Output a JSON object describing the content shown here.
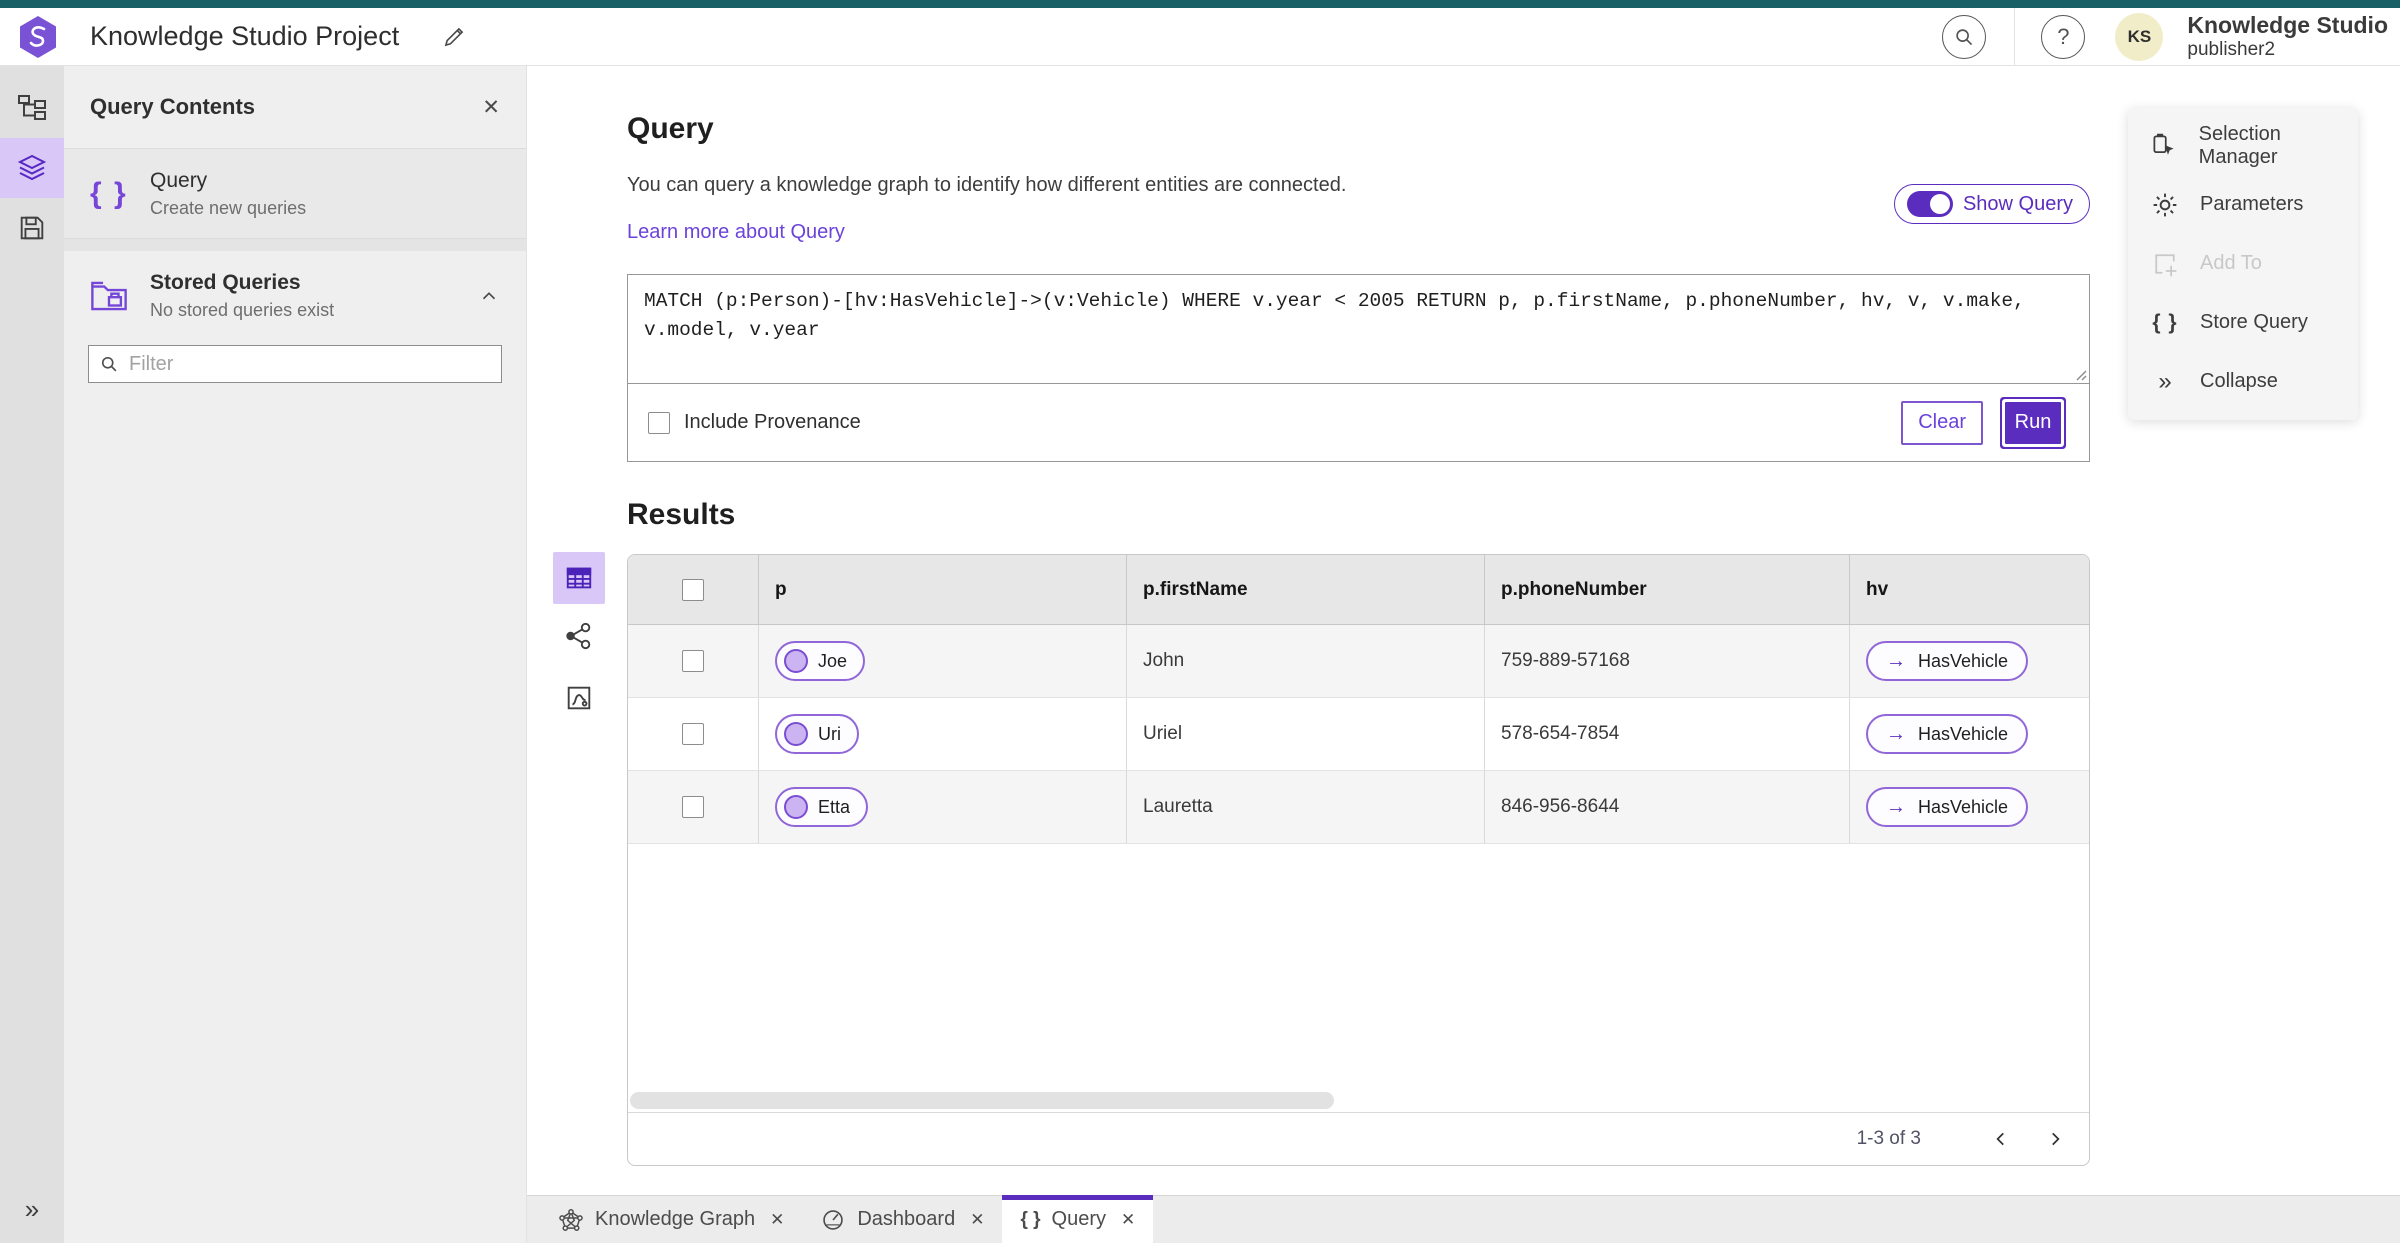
{
  "header": {
    "app_title": "Knowledge Studio Project",
    "user_name": "Knowledge Studio",
    "user_role": "publisher2",
    "avatar_initials": "KS"
  },
  "panel": {
    "title": "Query Contents",
    "query_item": {
      "label": "Query",
      "sublabel": "Create new queries"
    },
    "stored_item": {
      "label": "Stored Queries",
      "sublabel": "No stored queries exist"
    },
    "filter_placeholder": "Filter"
  },
  "query_section": {
    "title": "Query",
    "description": "You can query a knowledge graph to identify how different entities are connected.",
    "learn_more": "Learn more about Query",
    "show_query_label": "Show Query",
    "query_text": "MATCH (p:Person)-[hv:HasVehicle]->(v:Vehicle) WHERE v.year < 2005 RETURN p, p.firstName, p.phoneNumber, hv, v, v.make, v.model, v.year",
    "include_provenance_label": "Include Provenance",
    "clear_label": "Clear",
    "run_label": "Run"
  },
  "results": {
    "title": "Results",
    "columns": [
      "p",
      "p.firstName",
      "p.phoneNumber",
      "hv"
    ],
    "rows": [
      {
        "p": "Joe",
        "firstName": "John",
        "phoneNumber": "759-889-57168",
        "hv": "HasVehicle"
      },
      {
        "p": "Uri",
        "firstName": "Uriel",
        "phoneNumber": "578-654-7854",
        "hv": "HasVehicle"
      },
      {
        "p": "Etta",
        "firstName": "Lauretta",
        "phoneNumber": "846-956-8644",
        "hv": "HasVehicle"
      }
    ],
    "pagination": "1-3 of 3"
  },
  "right_menu": {
    "items": [
      {
        "label": "Selection Manager",
        "disabled": false
      },
      {
        "label": "Parameters",
        "disabled": false
      },
      {
        "label": "Add To",
        "disabled": true
      },
      {
        "label": "Store Query",
        "disabled": false
      },
      {
        "label": "Collapse",
        "disabled": false
      }
    ]
  },
  "tabs": [
    {
      "label": "Knowledge Graph",
      "active": false
    },
    {
      "label": "Dashboard",
      "active": false
    },
    {
      "label": "Query",
      "active": true
    }
  ],
  "icons": {
    "close": "✕",
    "braces": "{ }",
    "collapse": "»",
    "expand": "»",
    "arrow_right": "→",
    "help": "?"
  },
  "colors": {
    "primary_purple": "#5b2dbf",
    "light_purple_bg": "#d9c7f8",
    "pill_border_purple": "#9066d9",
    "link_purple": "#6b43da",
    "teal_top_strip": "#185f66",
    "avatar_bg": "#f2edc9"
  }
}
